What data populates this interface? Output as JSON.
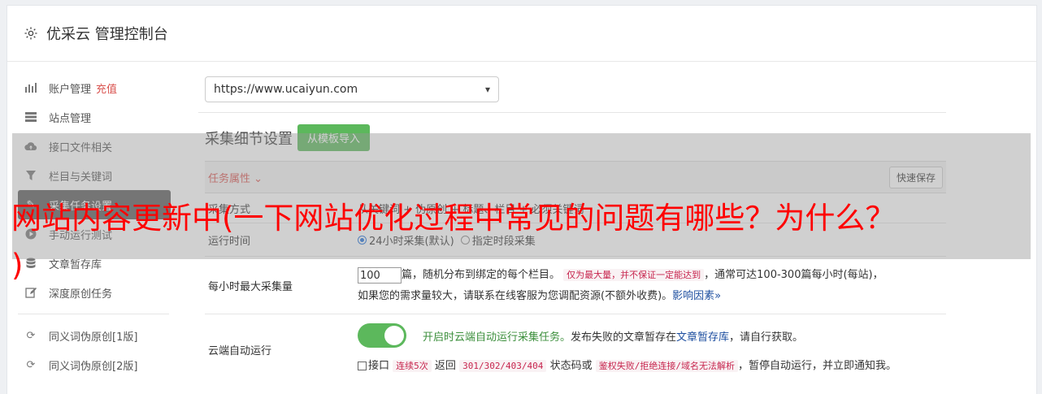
{
  "header": {
    "title": "优采云 管理控制台"
  },
  "sidebar": {
    "items": [
      {
        "label": "账户管理",
        "badge": "充值",
        "icon": "bar-chart-icon"
      },
      {
        "label": "站点管理",
        "icon": "server-icon"
      },
      {
        "label": "接口文件相关",
        "icon": "cloud-upload-icon"
      },
      {
        "label": "栏目与关键词",
        "icon": "filter-icon"
      },
      {
        "label": "采集任务设置",
        "icon": "wrench-icon",
        "active": true
      },
      {
        "label": "手动运行测试",
        "icon": "play-icon"
      },
      {
        "label": "文章暂存库",
        "icon": "database-icon"
      },
      {
        "label": "深度原创任务",
        "icon": "edit-icon"
      },
      {
        "label": "同义词伪原创[1版]",
        "icon": "refresh-icon"
      },
      {
        "label": "同义词伪原创[2版]",
        "icon": "refresh-icon"
      }
    ]
  },
  "main": {
    "site_select": "https://www.ucaiyun.com",
    "section_title": "采集细节设置",
    "import_button": "从模板导入",
    "task_attr": "任务属性",
    "quick_save": "快速保存",
    "rows": {
      "mode": {
        "label": "采集方式",
        "content": "从关键词 + 伪原创 + 标题、栏目 + 必须关键词"
      },
      "runtime": {
        "label": "运行时间",
        "opt1": "24小时采集(默认)",
        "opt2": "指定时段采集"
      },
      "max": {
        "label": "每小时最大采集量",
        "value": "100",
        "text1": "篇，随机分布到绑定的每个栏目。",
        "code1": "仅为最大量，并不保证一定能达到",
        "text2": "，通常可达100-300篇每小时(每站)，",
        "text3": "如果您的需求量较大，请联系在线客服为您调配资源(不额外收费)。",
        "link": "影响因素"
      },
      "cloud": {
        "label": "云端自动运行",
        "green_text": "开启时云端自动运行采集任务。",
        "text1": "发布失败的文章暂存在",
        "link": "文章暂存库",
        "text2": "，请自行获取。",
        "cb_text1": "接口",
        "code1": "连续5次",
        "text3": "返回",
        "code2": "301/302/403/404",
        "text4": "状态码或",
        "code3": "鉴权失败/拒绝连接/域名无法解析",
        "text5": "，暂停自动运行，并立即通知我。"
      }
    }
  },
  "overlay": {
    "line1": "网站内容更新中(一下网站优化过程中常见的问题有哪些？为什么？",
    "line2": ")"
  }
}
